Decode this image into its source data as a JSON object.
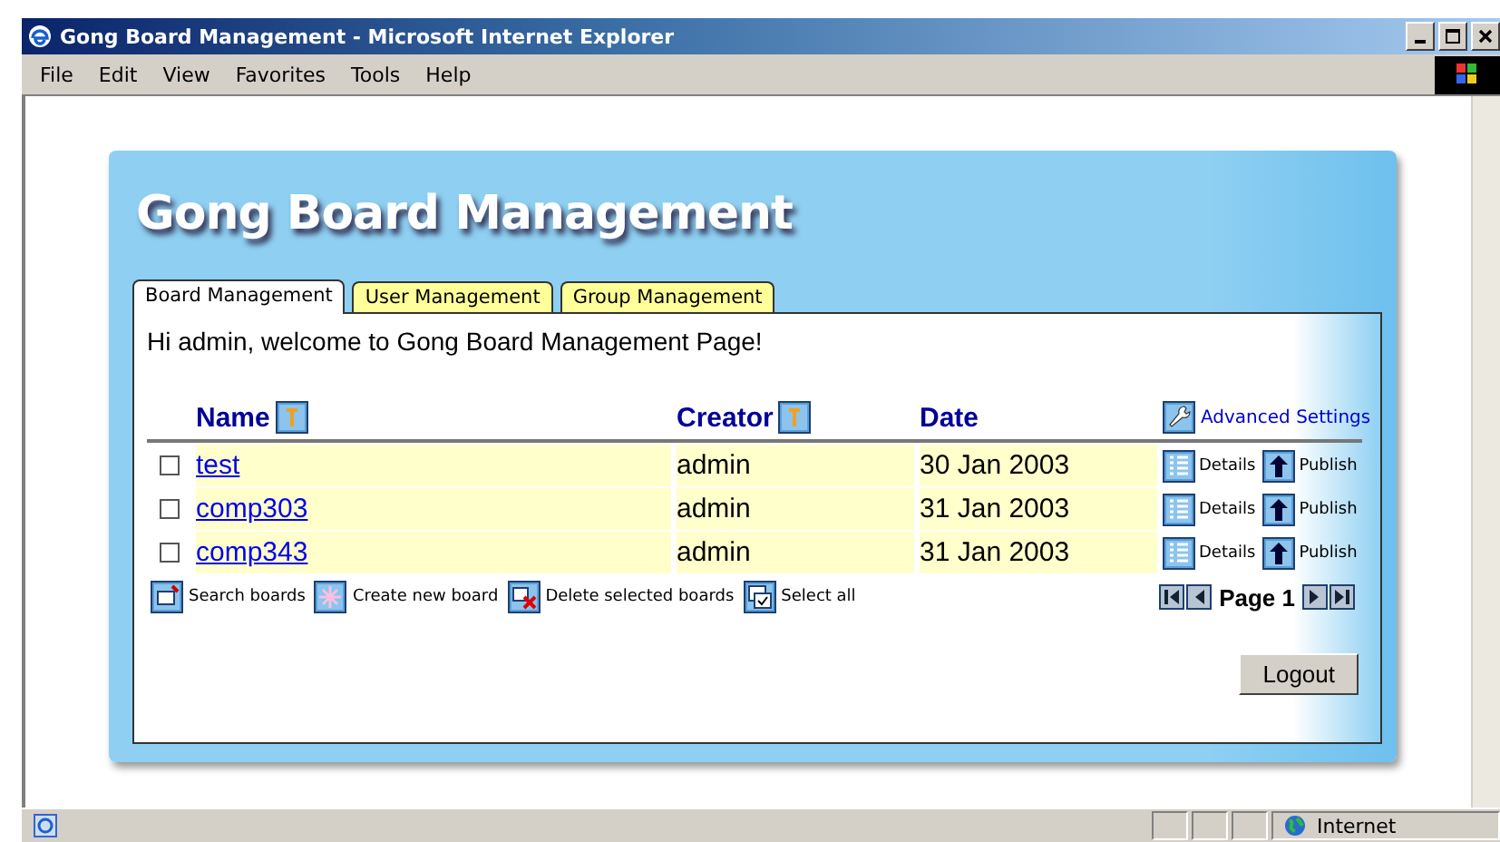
{
  "window": {
    "title": "Gong Board Management - Microsoft Internet Explorer"
  },
  "menu": [
    "File",
    "Edit",
    "View",
    "Favorites",
    "Tools",
    "Help"
  ],
  "page_title": "Gong Board Management",
  "tabs": [
    {
      "label": "Board Management",
      "selected": true
    },
    {
      "label": "User Management",
      "selected": false
    },
    {
      "label": "Group Management",
      "selected": false
    }
  ],
  "welcome": "Hi admin, welcome to Gong Board Management Page!",
  "columns": [
    {
      "label": "Name",
      "sortable": true
    },
    {
      "label": "Creator",
      "sortable": true
    },
    {
      "label": "Date",
      "sortable": false
    }
  ],
  "advanced_settings": "Advanced Settings",
  "rows": [
    {
      "checked": false,
      "name": "test",
      "creator": "admin",
      "date": "30 Jan 2003",
      "details": "Details",
      "publish": "Publish"
    },
    {
      "checked": false,
      "name": "comp303",
      "creator": "admin",
      "date": "31 Jan 2003",
      "details": "Details",
      "publish": "Publish"
    },
    {
      "checked": false,
      "name": "comp343",
      "creator": "admin",
      "date": "31 Jan 2003",
      "details": "Details",
      "publish": "Publish"
    }
  ],
  "actions": [
    {
      "kind": "search",
      "label": "Search boards"
    },
    {
      "kind": "create",
      "label": "Create new board"
    },
    {
      "kind": "delete",
      "label": "Delete selected boards"
    },
    {
      "kind": "selectall",
      "label": "Select all"
    }
  ],
  "pager": {
    "page": "Page 1"
  },
  "logout": "Logout",
  "status_bar": {
    "zone": "Internet"
  }
}
